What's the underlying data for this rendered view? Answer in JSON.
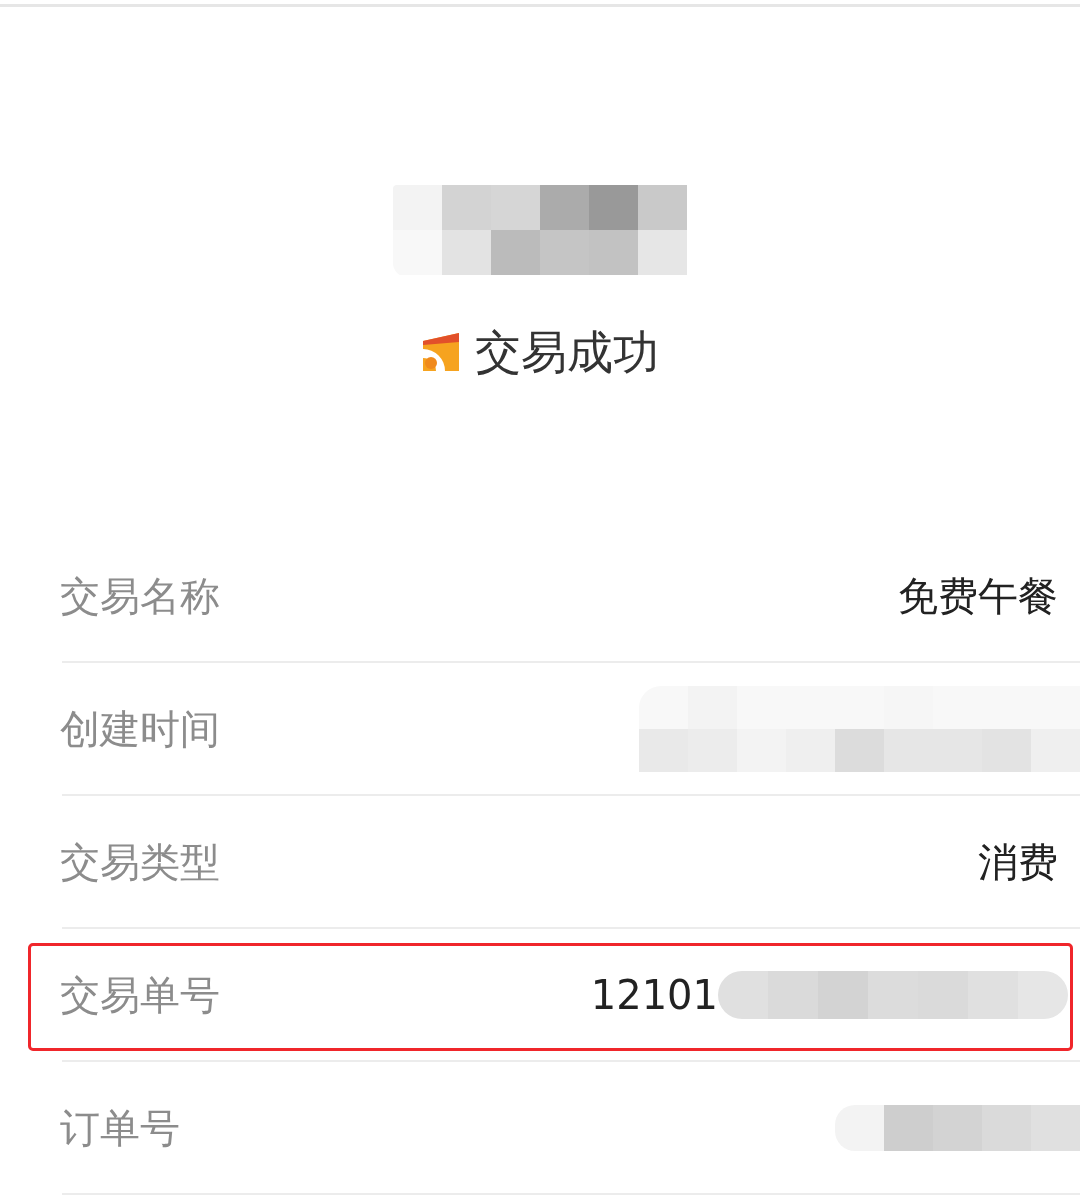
{
  "header": {
    "redacted": true
  },
  "status": {
    "text": "交易成功"
  },
  "rows": [
    {
      "label": "交易名称",
      "value": "免费午餐",
      "redacted": false,
      "highlighted": false
    },
    {
      "label": "创建时间",
      "redacted": true,
      "highlighted": false
    },
    {
      "label": "交易类型",
      "value": "消费",
      "redacted": false,
      "highlighted": false
    },
    {
      "label": "交易单号",
      "value": "12101",
      "redacted": true,
      "highlighted": true
    },
    {
      "label": "订单号",
      "redacted": true,
      "highlighted": false
    }
  ]
}
